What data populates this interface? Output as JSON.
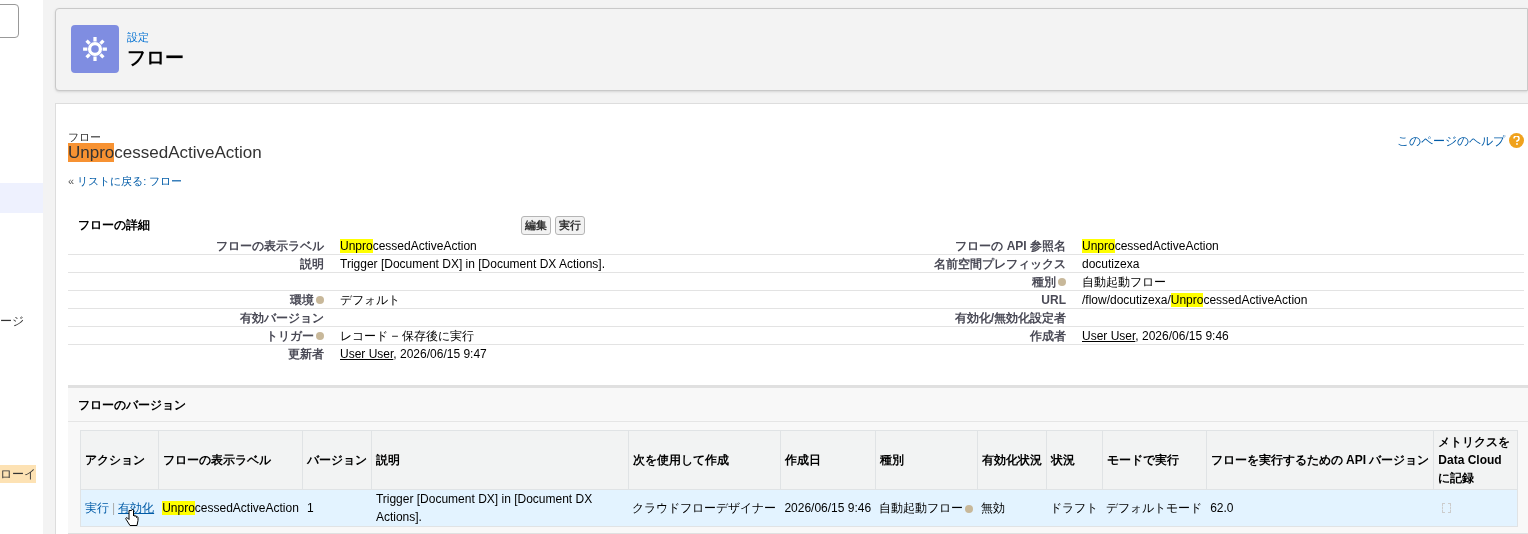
{
  "sidebar": {
    "items": [
      {
        "selected": true
      },
      {
        "label": "ージ",
        "selected": false
      },
      {
        "label": "ローイ",
        "selected": false,
        "highlight": true
      }
    ]
  },
  "header": {
    "breadcrumb": "設定",
    "title": "フロー"
  },
  "record": {
    "type_label": "フロー",
    "title": {
      "highlight": "Unpro",
      "rest": "cessedActiveAction"
    },
    "help_link": "このページのヘルプ",
    "back_mark": "«",
    "back_link": "リストに戻る: フロー"
  },
  "detail": {
    "title": "フローの詳細",
    "buttons": [
      "編集",
      "実行"
    ],
    "rows": [
      {
        "left": {
          "label": "フローの表示ラベル",
          "value": [
            {
              "kind": "highlight",
              "text": "Unpro"
            },
            {
              "kind": "text",
              "text": "cessedActiveAction"
            }
          ]
        },
        "right": {
          "label": "フローの API 参照名",
          "value": [
            {
              "kind": "highlight",
              "text": "Unpro"
            },
            {
              "kind": "text",
              "text": "cessedActiveAction"
            }
          ]
        }
      },
      {
        "left": {
          "label": "説明",
          "value": [
            {
              "kind": "text",
              "text": "Trigger [Document DX] in [Document DX Actions]."
            }
          ]
        },
        "right": {
          "label": "名前空間プレフィックス",
          "value": [
            {
              "kind": "text",
              "text": "docutizexa"
            }
          ]
        }
      },
      {
        "left": {},
        "right": {
          "label": "種別",
          "help": true,
          "value": [
            {
              "kind": "text",
              "text": "自動起動フロー"
            }
          ]
        }
      },
      {
        "left": {
          "label": "環境",
          "help": true,
          "value": [
            {
              "kind": "text",
              "text": "デフォルト"
            }
          ]
        },
        "right": {
          "label": "URL",
          "value": [
            {
              "kind": "text",
              "text": "/flow/docutizexa/"
            },
            {
              "kind": "highlight",
              "text": "Unpro"
            },
            {
              "kind": "text",
              "text": "cessedActiveAction"
            }
          ]
        }
      },
      {
        "left": {
          "label": "有効バージョン"
        },
        "right": {
          "label": "有効化/無効化設定者"
        }
      },
      {
        "left": {
          "label": "トリガー",
          "help": true,
          "value": [
            {
              "kind": "text",
              "text": "レコード − 保存後に実行"
            }
          ]
        },
        "right": {
          "label": "作成者",
          "value": [
            {
              "kind": "link",
              "text": "User User"
            },
            {
              "kind": "text",
              "text": ", 2026/06/15 9:46"
            }
          ]
        }
      },
      {
        "left": {
          "label": "更新者",
          "value": [
            {
              "kind": "link",
              "text": "User User"
            },
            {
              "kind": "text",
              "text": ", 2026/06/15 9:47"
            }
          ]
        }
      }
    ]
  },
  "versions": {
    "title": "フローのバージョン",
    "columns": [
      "アクション",
      "フローの表示ラベル",
      "バージョン",
      "説明",
      "次を使用して作成",
      "作成日",
      "種別",
      "有効化状況",
      "状況",
      "モードで実行",
      "フローを実行するための API バージョン",
      "メトリクスを Data Cloud に記録"
    ],
    "rows": [
      {
        "actions": [
          "実行",
          "|",
          "有効化"
        ],
        "label": {
          "highlight": "Unpro",
          "rest": "cessedActiveAction"
        },
        "version": "1",
        "description": "Trigger [Document DX] in [Document DX Actions].",
        "created_with": "クラウドフローデザイナー",
        "created_date": "2026/06/15 9:46",
        "type": "自動起動フロー",
        "type_help": true,
        "activation": "無効",
        "status": "ドラフト",
        "run_mode": "デフォルトモード",
        "api_version": "62.0",
        "metrics_checked": false
      }
    ]
  }
}
